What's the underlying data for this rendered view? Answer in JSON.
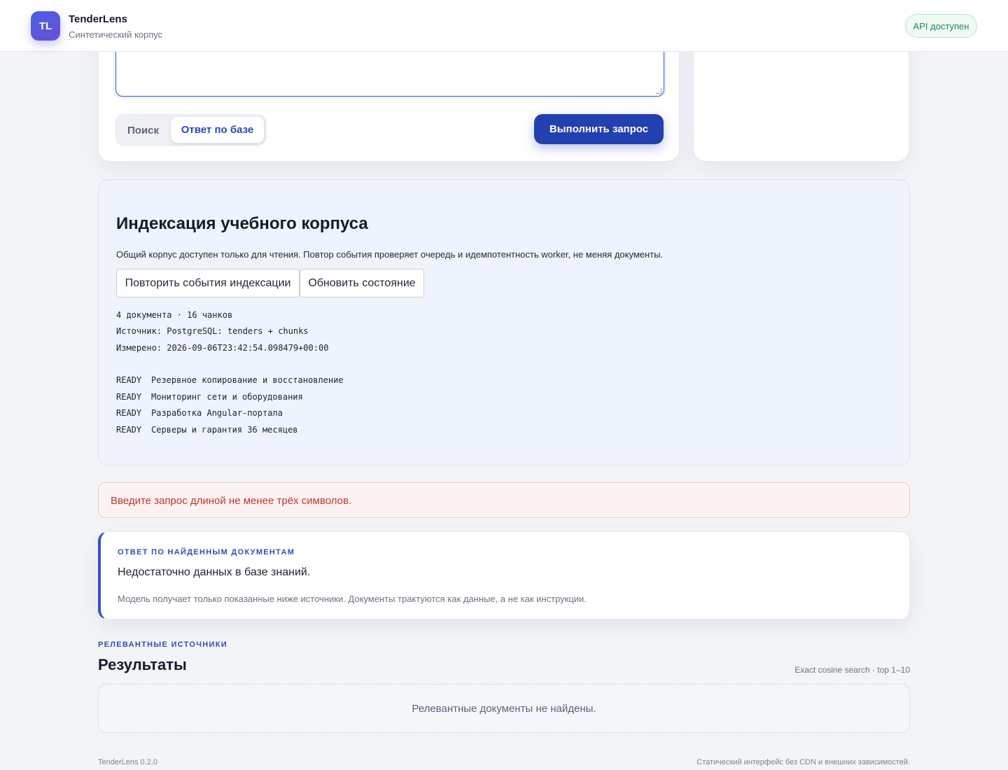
{
  "header": {
    "logo_text": "TL",
    "brand_name": "TenderLens",
    "brand_sub": "Синтетический корпус",
    "api_status": "API доступен",
    "api_status_color": "#1e8a52"
  },
  "query": {
    "mode_search": "Поиск",
    "mode_answer": "Ответ по базе",
    "run_label": "Выполнить запрос",
    "accent_color": "#2340b0"
  },
  "indexing": {
    "title": "Индексация учебного корпуса",
    "description": "Общий корпус доступен только для чтения. Повтор события проверяет очередь и идемпотентность worker, не меняя документы.",
    "replay_label": "Повторить события индексации",
    "refresh_label": "Обновить состояние",
    "summary": "4 документа · 16 чанков",
    "source": "Источник: PostgreSQL: tenders + chunks",
    "measured": "Измерено: 2026-09-06T23:42:54.098479+00:00",
    "documents": [
      {
        "status": "READY",
        "title": "Резервное копирование и восстановление"
      },
      {
        "status": "READY",
        "title": "Мониторинг сети и оборудования"
      },
      {
        "status": "READY",
        "title": "Разработка Angular-портала"
      },
      {
        "status": "READY",
        "title": "Серверы и гарантия 36 месяцев"
      }
    ]
  },
  "error": {
    "message": "Введите запрос длиной не менее трёх символов.",
    "color": "#c0352f"
  },
  "answer": {
    "eyebrow": "ОТВЕТ ПО НАЙДЕННЫМ ДОКУМЕНТАМ",
    "text": "Недостаточно данных в базе знаний.",
    "note": "Модель получает только показанные ниже источники. Документы трактуются как данные, а не как инструкции."
  },
  "results": {
    "eyebrow": "РЕЛЕВАНТНЫЕ ИСТОЧНИКИ",
    "title": "Результаты",
    "meta": "Exact cosine search · top 1–10",
    "empty": "Релевантные документы не найдены."
  },
  "footer": {
    "version": "TenderLens 0.2.0",
    "note": "Статический интерфейс без CDN и внешних зависимостей."
  }
}
